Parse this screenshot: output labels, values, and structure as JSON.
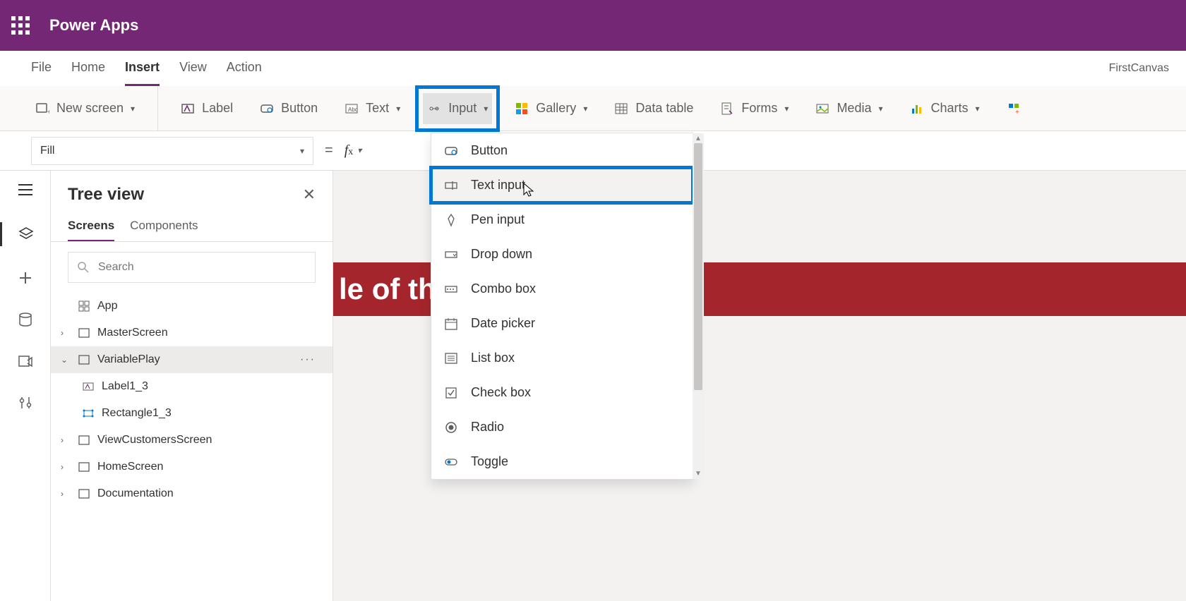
{
  "header": {
    "product": "Power Apps",
    "app_name": "FirstCanvas"
  },
  "menu": {
    "items": [
      "File",
      "Home",
      "Insert",
      "View",
      "Action"
    ],
    "active_index": 2
  },
  "ribbon": {
    "new_screen": "New screen",
    "label": "Label",
    "button": "Button",
    "text": "Text",
    "input": "Input",
    "gallery": "Gallery",
    "data_table": "Data table",
    "forms": "Forms",
    "media": "Media",
    "charts": "Charts"
  },
  "formula": {
    "property": "Fill",
    "equals": "="
  },
  "sidepanel": {
    "title": "Tree view",
    "tabs": [
      "Screens",
      "Components"
    ],
    "active_tab": 0,
    "search_placeholder": "Search",
    "app_node": "App",
    "nodes": [
      {
        "name": "MasterScreen",
        "expanded": false,
        "selected": false,
        "children": []
      },
      {
        "name": "VariablePlay",
        "expanded": true,
        "selected": true,
        "children": [
          {
            "name": "Label1_3",
            "kind": "label"
          },
          {
            "name": "Rectangle1_3",
            "kind": "rect"
          }
        ]
      },
      {
        "name": "ViewCustomersScreen",
        "expanded": false,
        "selected": false,
        "children": []
      },
      {
        "name": "HomeScreen",
        "expanded": false,
        "selected": false,
        "children": []
      },
      {
        "name": "Documentation",
        "expanded": false,
        "selected": false,
        "children": []
      }
    ]
  },
  "dropdown": {
    "items": [
      "Button",
      "Text input",
      "Pen input",
      "Drop down",
      "Combo box",
      "Date picker",
      "List box",
      "Check box",
      "Radio",
      "Toggle"
    ],
    "highlighted_index": 1
  },
  "canvas": {
    "title_fragment": "le of the Screen"
  }
}
